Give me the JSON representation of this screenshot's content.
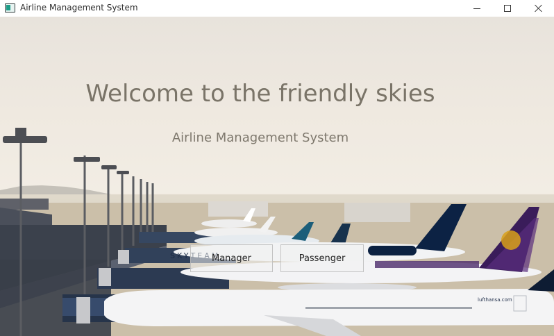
{
  "window": {
    "title": "Airline Management System",
    "icon": "app-window-icon",
    "controls": [
      "minimize-icon",
      "maximize-icon",
      "close-icon"
    ]
  },
  "hero": {
    "headline": "Welcome to the friendly skies",
    "subtitle": "Airline Management System",
    "background": "airport-apron-photo"
  },
  "actions": {
    "manager_label": "Manager",
    "passenger_label": "Passenger"
  },
  "photo_text": {
    "aircraft_1": "SKYTEAM",
    "aircraft_2": "lufthansa.com"
  },
  "colors": {
    "headline": "#7a7468",
    "sky": "#efe9e0",
    "tarmac": "#c9bda7"
  }
}
